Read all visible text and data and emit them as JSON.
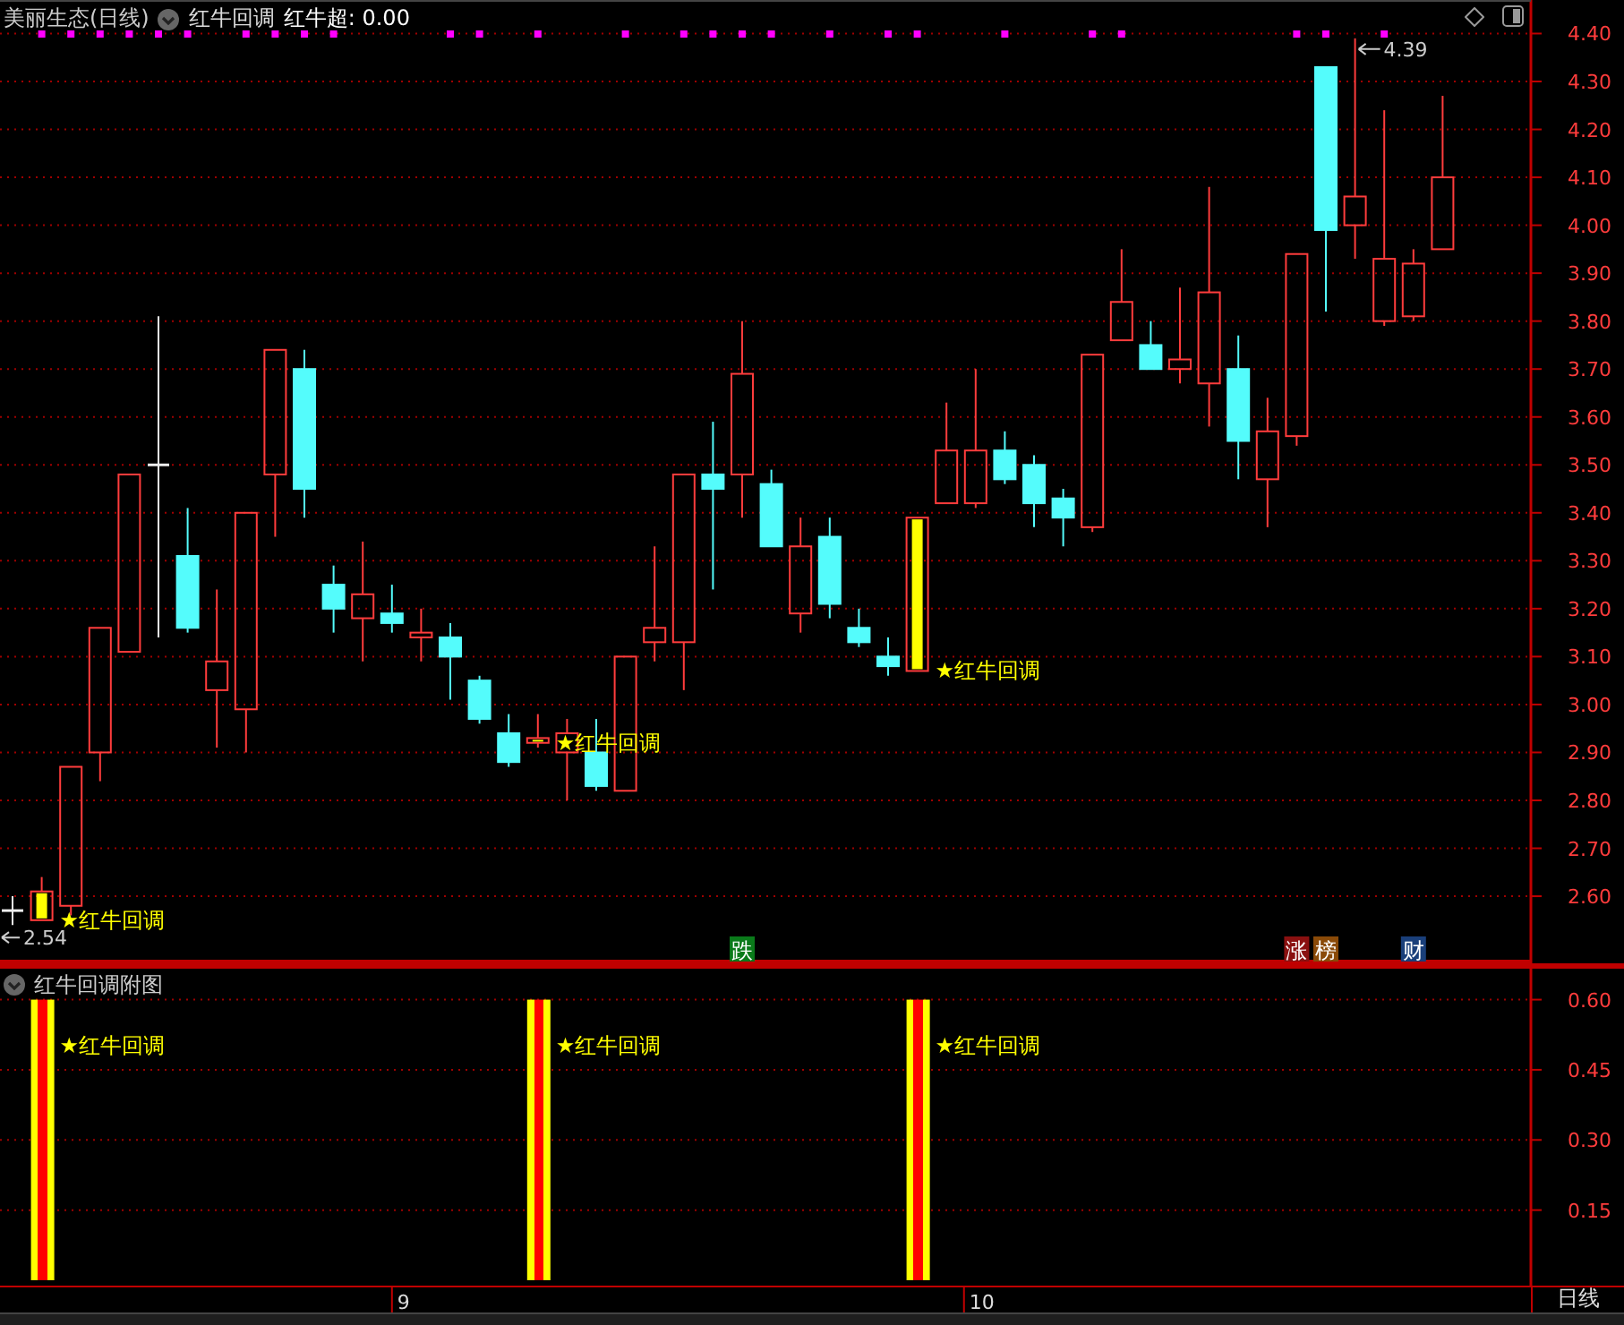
{
  "header": {
    "stock": "美丽生态(日线)",
    "indicator": "红牛回调",
    "reading": "红牛超: 0.00"
  },
  "price_chart": {
    "chart_data": {
      "type": "candlestick",
      "grid": true,
      "ylim": [
        2.46,
        4.47
      ],
      "yticks": [
        {
          "value": 2.6,
          "label": "2.60"
        },
        {
          "value": 2.7,
          "label": "2.70"
        },
        {
          "value": 2.8,
          "label": "2.80"
        },
        {
          "value": 2.9,
          "label": "2.90"
        },
        {
          "value": 3.0,
          "label": "3.00"
        },
        {
          "value": 3.1,
          "label": "3.10"
        },
        {
          "value": 3.2,
          "label": "3.20"
        },
        {
          "value": 3.3,
          "label": "3.30"
        },
        {
          "value": 3.4,
          "label": "3.40"
        },
        {
          "value": 3.5,
          "label": "3.50"
        },
        {
          "value": 3.6,
          "label": "3.60"
        },
        {
          "value": 3.7,
          "label": "3.70"
        },
        {
          "value": 3.8,
          "label": "3.80"
        },
        {
          "value": 3.9,
          "label": "3.90"
        },
        {
          "value": 4.0,
          "label": "4.00"
        },
        {
          "value": 4.1,
          "label": "4.10"
        },
        {
          "value": 4.2,
          "label": "4.20"
        },
        {
          "value": 4.3,
          "label": "4.30"
        },
        {
          "value": 4.4,
          "label": "4.40"
        }
      ],
      "ohlc": [
        [
          2.57,
          2.6,
          2.54,
          2.57
        ],
        [
          2.55,
          2.64,
          2.55,
          2.61
        ],
        [
          2.58,
          2.87,
          2.56,
          2.87
        ],
        [
          2.9,
          3.16,
          2.84,
          3.16
        ],
        [
          3.11,
          3.48,
          3.11,
          3.48
        ],
        [
          3.5,
          3.81,
          3.14,
          3.5
        ],
        [
          3.31,
          3.41,
          3.15,
          3.16
        ],
        [
          3.03,
          3.24,
          2.91,
          3.09
        ],
        [
          2.99,
          3.4,
          2.9,
          3.4
        ],
        [
          3.48,
          3.74,
          3.35,
          3.74
        ],
        [
          3.7,
          3.74,
          3.39,
          3.45
        ],
        [
          3.25,
          3.29,
          3.15,
          3.2
        ],
        [
          3.18,
          3.34,
          3.09,
          3.23
        ],
        [
          3.19,
          3.25,
          3.15,
          3.17
        ],
        [
          3.14,
          3.2,
          3.09,
          3.15
        ],
        [
          3.14,
          3.17,
          3.01,
          3.1
        ],
        [
          3.05,
          3.06,
          2.96,
          2.97
        ],
        [
          2.94,
          2.98,
          2.87,
          2.88
        ],
        [
          2.92,
          2.98,
          2.91,
          2.93
        ],
        [
          2.9,
          2.97,
          2.8,
          2.94
        ],
        [
          2.9,
          2.97,
          2.82,
          2.83
        ],
        [
          2.82,
          3.1,
          2.82,
          3.1
        ],
        [
          3.13,
          3.33,
          3.09,
          3.16
        ],
        [
          3.13,
          3.48,
          3.03,
          3.48
        ],
        [
          3.48,
          3.59,
          3.24,
          3.45
        ],
        [
          3.48,
          3.8,
          3.39,
          3.69
        ],
        [
          3.46,
          3.49,
          3.33,
          3.33
        ],
        [
          3.19,
          3.39,
          3.15,
          3.33
        ],
        [
          3.35,
          3.39,
          3.18,
          3.21
        ],
        [
          3.16,
          3.2,
          3.12,
          3.13
        ],
        [
          3.1,
          3.14,
          3.06,
          3.08
        ],
        [
          3.07,
          3.39,
          3.07,
          3.39
        ],
        [
          3.42,
          3.63,
          3.42,
          3.53
        ],
        [
          3.42,
          3.7,
          3.41,
          3.53
        ],
        [
          3.53,
          3.57,
          3.46,
          3.47
        ],
        [
          3.5,
          3.52,
          3.37,
          3.42
        ],
        [
          3.43,
          3.45,
          3.33,
          3.39
        ],
        [
          3.37,
          3.73,
          3.36,
          3.73
        ],
        [
          3.76,
          3.95,
          3.76,
          3.84
        ],
        [
          3.75,
          3.8,
          3.7,
          3.7
        ],
        [
          3.7,
          3.87,
          3.67,
          3.72
        ],
        [
          3.67,
          4.08,
          3.58,
          3.86
        ],
        [
          3.7,
          3.77,
          3.47,
          3.55
        ],
        [
          3.47,
          3.64,
          3.37,
          3.57
        ],
        [
          3.56,
          3.94,
          3.54,
          3.94
        ],
        [
          4.33,
          4.33,
          3.82,
          3.99
        ],
        [
          4.0,
          4.39,
          3.93,
          4.06
        ],
        [
          3.8,
          4.24,
          3.79,
          3.93
        ],
        [
          3.81,
          3.95,
          3.8,
          3.92
        ],
        [
          3.95,
          4.27,
          3.95,
          4.1
        ]
      ],
      "annotations": [
        "★红牛回调",
        "★红牛回调",
        "★红牛回调"
      ]
    },
    "low_label": {
      "text": "2.54"
    },
    "high_label": {
      "text": "4.39"
    },
    "dots": [
      {
        "on": false
      },
      {
        "on": true
      },
      {
        "on": true
      },
      {
        "on": true
      },
      {
        "on": true
      },
      {
        "on": true
      },
      {
        "on": true
      },
      {
        "on": false
      },
      {
        "on": true
      },
      {
        "on": true
      },
      {
        "on": true
      },
      {
        "on": true
      },
      {
        "on": false
      },
      {
        "on": false
      },
      {
        "on": false
      },
      {
        "on": true
      },
      {
        "on": true
      },
      {
        "on": false
      },
      {
        "on": true
      },
      {
        "on": false
      },
      {
        "on": false
      },
      {
        "on": true
      },
      {
        "on": false
      },
      {
        "on": true
      },
      {
        "on": true
      },
      {
        "on": true
      },
      {
        "on": true
      },
      {
        "on": false
      },
      {
        "on": true
      },
      {
        "on": false
      },
      {
        "on": true
      },
      {
        "on": true
      },
      {
        "on": false
      },
      {
        "on": false
      },
      {
        "on": true
      },
      {
        "on": false
      },
      {
        "on": false
      },
      {
        "on": true
      },
      {
        "on": true
      },
      {
        "on": false
      },
      {
        "on": false
      },
      {
        "on": false
      },
      {
        "on": false
      },
      {
        "on": false
      },
      {
        "on": true
      },
      {
        "on": true
      },
      {
        "on": false
      },
      {
        "on": true
      },
      {
        "on": false
      },
      {
        "on": false
      }
    ],
    "events": [
      {
        "text": "跌",
        "color": "#0a7a1a"
      },
      {
        "text": "涨",
        "color": "#8a1010"
      },
      {
        "text": "榜",
        "color": "#8a4a08"
      },
      {
        "text": "财",
        "color": "#1a3f7a"
      }
    ]
  },
  "sub_chart": {
    "title": "红牛回调附图",
    "chart_data": {
      "type": "bar",
      "grid": true,
      "ylim": [
        0,
        0.67
      ],
      "values": [
        null,
        0.6,
        null,
        null,
        null,
        null,
        null,
        null,
        null,
        null,
        null,
        null,
        null,
        null,
        null,
        null,
        null,
        null,
        0.6,
        null,
        null,
        null,
        null,
        null,
        null,
        null,
        null,
        null,
        null,
        null,
        null,
        0.6,
        null,
        null,
        null,
        null,
        null,
        null,
        null,
        null,
        null,
        null,
        null,
        null,
        null,
        null,
        null,
        null,
        null,
        null
      ],
      "yticks": [
        {
          "value": 0.15,
          "label": "0.15"
        },
        {
          "value": 0.3,
          "label": "0.30"
        },
        {
          "value": 0.45,
          "label": "0.45"
        },
        {
          "value": 0.6,
          "label": "0.60"
        }
      ],
      "annotations": [
        "★红牛回调",
        "★红牛回调",
        "★红牛回调"
      ]
    }
  },
  "date_labels": [
    "9",
    "10"
  ],
  "period_button": "日线"
}
